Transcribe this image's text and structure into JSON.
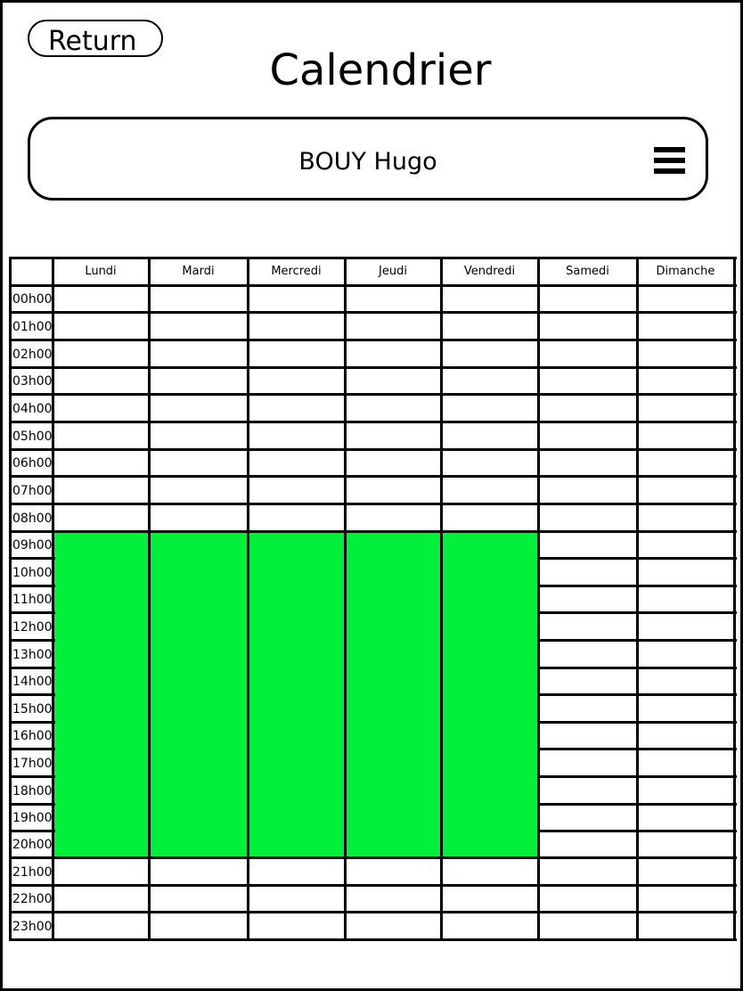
{
  "header": {
    "return_label": "Return",
    "title": "Calendrier"
  },
  "user_bar": {
    "name": "BOUY Hugo",
    "menu_icon": "hamburger-menu-icon"
  },
  "calendar": {
    "days": [
      "Lundi",
      "Mardi",
      "Mercredi",
      "Jeudi",
      "Vendredi",
      "Samedi",
      "Dimanche"
    ],
    "hours": [
      "00h00",
      "01h00",
      "02h00",
      "03h00",
      "04h00",
      "05h00",
      "06h00",
      "07h00",
      "08h00",
      "09h00",
      "10h00",
      "11h00",
      "12h00",
      "13h00",
      "14h00",
      "15h00",
      "16h00",
      "17h00",
      "18h00",
      "19h00",
      "20h00",
      "21h00",
      "22h00",
      "23h00"
    ],
    "busy": {
      "days": [
        "Lundi",
        "Mardi",
        "Mercredi",
        "Jeudi",
        "Vendredi"
      ],
      "from_hour": "09h00",
      "to_hour": "20h00"
    },
    "colors": {
      "busy": "#00f03c",
      "grid": "#000000"
    }
  }
}
